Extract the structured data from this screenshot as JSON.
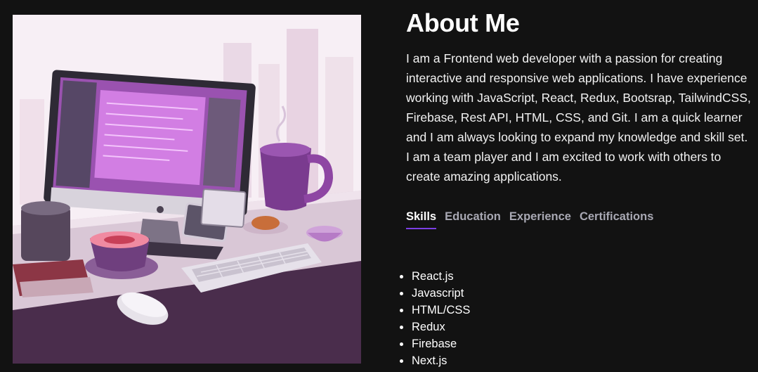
{
  "illustration": {
    "description_icon": "workspace-illustration"
  },
  "about": {
    "title": "About Me",
    "paragraph": "I am a Frontend web developer with a passion for creating interactive and responsive web applications. I have experience working with JavaScript, React, Redux, Bootsrap, TailwindCSS, Firebase, Rest API, HTML, CSS, and Git. I am a quick learner and I am always looking to expand my knowledge and skill set. I am a team player and I am excited to work with others to create amazing applications."
  },
  "tabs": [
    {
      "label": "Skills",
      "active": true
    },
    {
      "label": "Education",
      "active": false
    },
    {
      "label": "Experience",
      "active": false
    },
    {
      "label": "Certifications",
      "active": false
    }
  ],
  "skills": [
    "React.js",
    "Javascript",
    "HTML/CSS",
    "Redux",
    "Firebase",
    "Next.js"
  ],
  "colors": {
    "background": "#121212",
    "accent": "#7b3fe4",
    "tab_inactive": "#a8a8b3"
  }
}
